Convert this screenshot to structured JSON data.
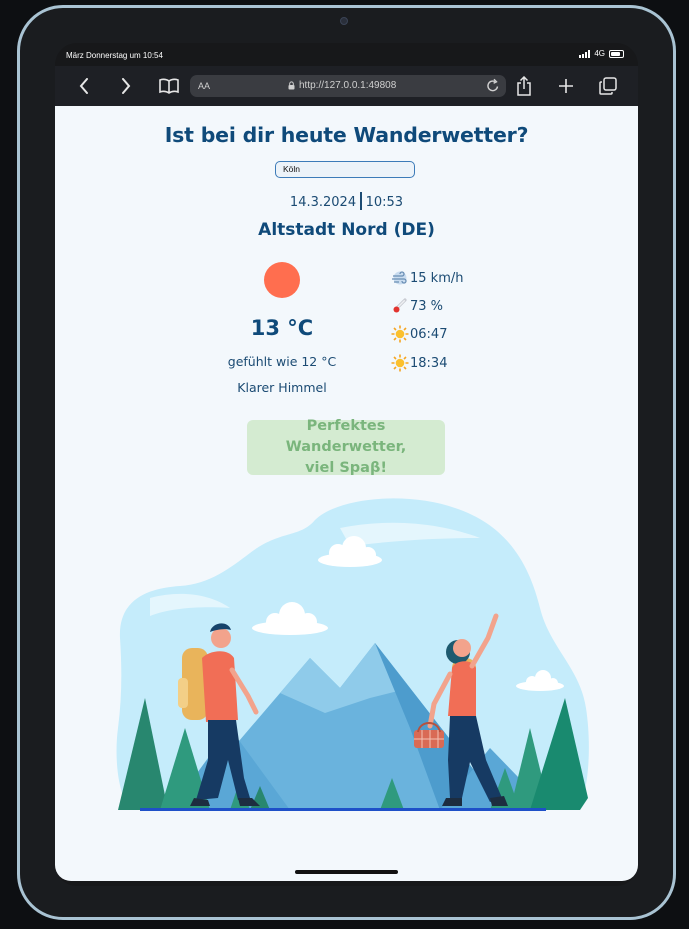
{
  "status": {
    "time": "März Donnerstag um 10:54",
    "network": "4G"
  },
  "browser": {
    "text_size_label": "AA",
    "url": "http://127.0.0.1:49808"
  },
  "page": {
    "title": "Ist bei dir heute Wanderwetter?",
    "city_value": "Köln",
    "date": "14.3.2024",
    "time": "10:53",
    "location": "Altstadt Nord (DE)",
    "temperature": "13 °C",
    "feels_like": "gefühlt wie 12 °C",
    "description": "Klarer Himmel",
    "wind": "15 km/h",
    "humidity": "73 %",
    "sunrise": "06:47",
    "sunset": "18:34",
    "verdict_line1": "Perfektes Wanderwetter,",
    "verdict_line2": "viel Spaβ!"
  },
  "colors": {
    "heading": "#0f4a7a",
    "sun": "#ff6e4f",
    "verdict_bg": "#d4ebd1",
    "verdict_text": "#7ab57c"
  },
  "icons": [
    "chevron-left-icon",
    "chevron-right-icon",
    "book-icon",
    "lock-icon",
    "reload-icon",
    "share-icon",
    "plus-icon",
    "tabs-icon",
    "wind-icon",
    "thermometer-icon",
    "sunrise-icon",
    "sunset-icon"
  ]
}
